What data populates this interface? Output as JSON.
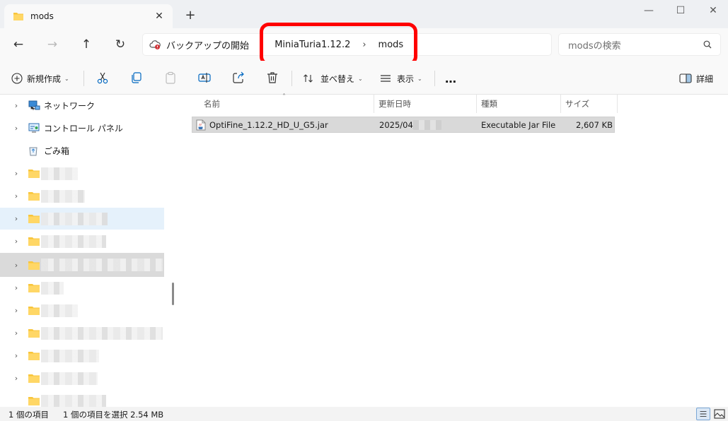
{
  "tab": {
    "title": "mods",
    "close": "✕",
    "new": "+"
  },
  "window": {
    "minimize": "—",
    "maximize": "☐",
    "close": "✕"
  },
  "nav": {
    "back": "←",
    "forward": "→",
    "up": "↑",
    "refresh": "↻"
  },
  "breadcrumb": {
    "items": [
      "バックアップの開始",
      "MiniaTuria1.12.2",
      "mods"
    ],
    "separator": "›"
  },
  "search": {
    "placeholder": "modsの検索"
  },
  "commands": {
    "new": "新規作成",
    "sort": "並べ替え",
    "view": "表示",
    "more": "…",
    "details": "詳細"
  },
  "sidebar": {
    "items": [
      {
        "label": "ネットワーク",
        "icon": "network-icon"
      },
      {
        "label": "コントロール パネル",
        "icon": "control-panel-icon"
      },
      {
        "label": "ごみ箱",
        "icon": "recycle-bin-icon"
      }
    ]
  },
  "columns": {
    "name": "名前",
    "date": "更新日時",
    "type": "種類",
    "size": "サイズ"
  },
  "files": [
    {
      "name": "OptiFine_1.12.2_HD_U_G5.jar",
      "date": "2025/04/",
      "type": "Executable Jar File",
      "size": "2,607 KB"
    }
  ],
  "status": {
    "count": "1 個の項目",
    "selected": "1 個の項目を選択  2.54 MB"
  },
  "colors": {
    "accent": "#0067c0",
    "highlight": "#ff0000",
    "folder": "#f8c53a"
  }
}
